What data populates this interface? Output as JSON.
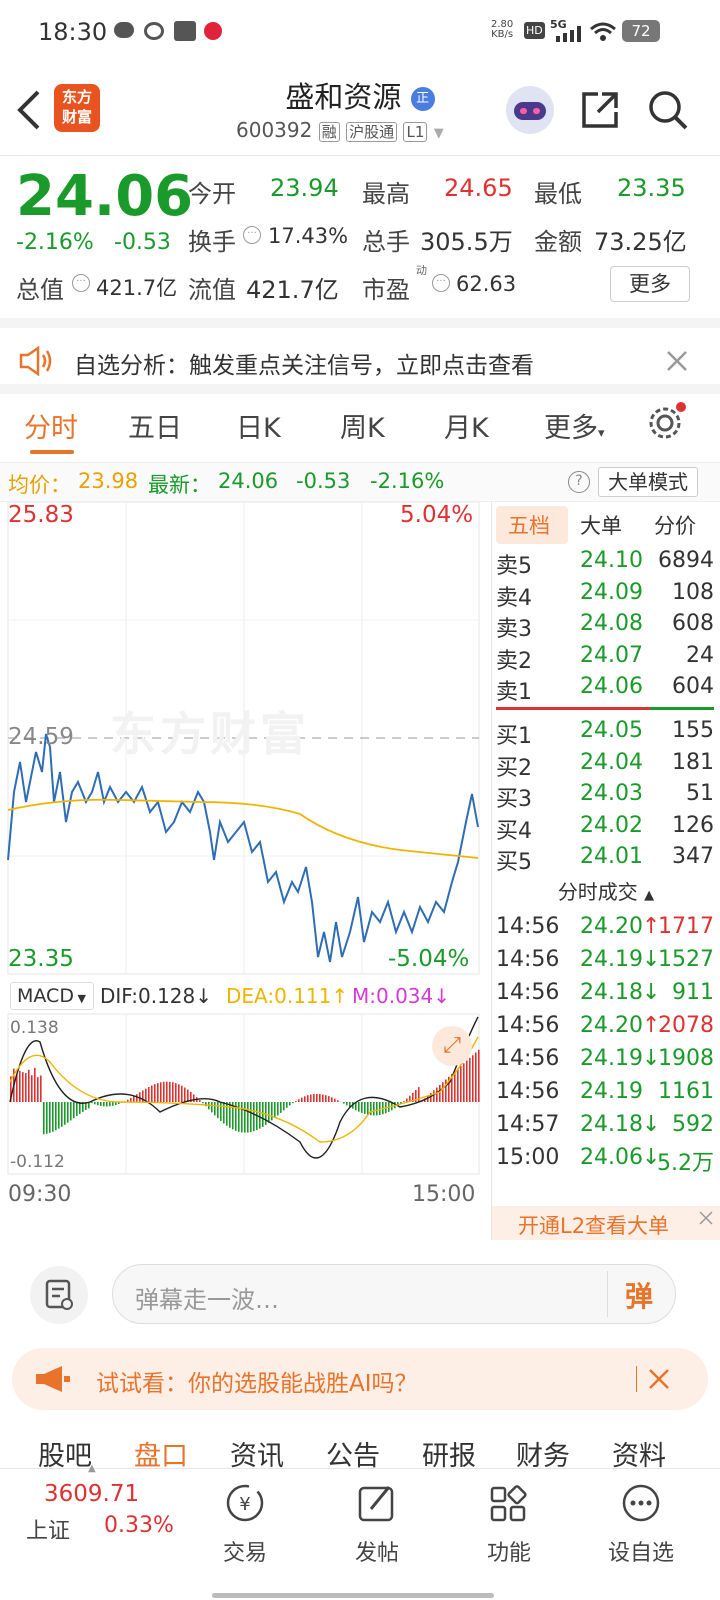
{
  "status_bar": {
    "time": "18:30",
    "net_speed_top": "2.80",
    "net_speed_bottom": "KB/s",
    "hd": "HD",
    "network": "5G",
    "battery": "72"
  },
  "header": {
    "logo_line1": "东方",
    "logo_line2": "财富",
    "stock_name": "盛和资源",
    "name_badge": "正",
    "code": "600392",
    "tag_margin": "融",
    "tag_connect": "沪股通",
    "tag_level": "L1"
  },
  "quote": {
    "price": "24.06",
    "change_pct": "-2.16%",
    "change": "-0.53",
    "open_label": "今开",
    "open": "23.94",
    "high_label": "最高",
    "high": "24.65",
    "low_label": "最低",
    "low": "23.35",
    "turnover_label": "换手",
    "turnover": "17.43%",
    "volume_label": "总手",
    "volume": "305.5万",
    "amount_label": "金额",
    "amount": "73.25亿",
    "mktcap_label": "总值",
    "mktcap": "421.7亿",
    "float_label": "流值",
    "float": "421.7亿",
    "pe_label": "市盈",
    "pe_sup": "动",
    "pe": "62.63",
    "more": "更多"
  },
  "banner": {
    "text": "自选分析：触发重点关注信号，立即点击查看"
  },
  "tabs": [
    "分时",
    "五日",
    "日K",
    "周K",
    "月K",
    "更多"
  ],
  "infoline": {
    "avg_label": "均价：",
    "avg": "23.98",
    "latest_label": "最新：",
    "latest": "24.06",
    "chg": "-0.53",
    "chg_pct": "-2.16%",
    "mode": "大单模式"
  },
  "chart": {
    "y_top": "25.83",
    "y_top_pct": "5.04%",
    "ref": "24.59",
    "y_bottom": "23.35",
    "y_bottom_pct": "-5.04%",
    "watermark": "东方财富",
    "x_start": "09:30",
    "x_end": "15:00",
    "macd_label": "MACD",
    "dif": "DIF:0.128",
    "dea": "DEA:0.111",
    "m": "M:0.034",
    "macd_top": "0.138",
    "macd_bottom": "-0.112",
    "colors": {
      "price": "#2e6db4",
      "avg": "#f0b400",
      "up": "#e03131",
      "down": "#1a9a2a"
    }
  },
  "book": {
    "tabs": [
      "五档",
      "大单",
      "分价"
    ],
    "asks": [
      {
        "label": "卖5",
        "price": "24.10",
        "vol": "6894"
      },
      {
        "label": "卖4",
        "price": "24.09",
        "vol": "108"
      },
      {
        "label": "卖3",
        "price": "24.08",
        "vol": "608"
      },
      {
        "label": "卖2",
        "price": "24.07",
        "vol": "24"
      },
      {
        "label": "卖1",
        "price": "24.06",
        "vol": "604"
      }
    ],
    "bids": [
      {
        "label": "买1",
        "price": "24.05",
        "vol": "155"
      },
      {
        "label": "买2",
        "price": "24.04",
        "vol": "181"
      },
      {
        "label": "买3",
        "price": "24.03",
        "vol": "51"
      },
      {
        "label": "买4",
        "price": "24.02",
        "vol": "126"
      },
      {
        "label": "买5",
        "price": "24.01",
        "vol": "347"
      }
    ],
    "ticks_title": "分时成交",
    "ticks": [
      {
        "time": "14:56",
        "price": "24.20",
        "dir": "↑",
        "vol": "1717"
      },
      {
        "time": "14:56",
        "price": "24.19",
        "dir": "↓",
        "vol": "1527"
      },
      {
        "time": "14:56",
        "price": "24.18",
        "dir": "↓",
        "vol": "911"
      },
      {
        "time": "14:56",
        "price": "24.20",
        "dir": "↑",
        "vol": "2078"
      },
      {
        "time": "14:56",
        "price": "24.19",
        "dir": "↓",
        "vol": "1908"
      },
      {
        "time": "14:56",
        "price": "24.19",
        "dir": "",
        "vol": "1161"
      },
      {
        "time": "14:57",
        "price": "24.18",
        "dir": "↓",
        "vol": "592"
      },
      {
        "time": "15:00",
        "price": "24.06",
        "dir": "↓",
        "vol": "5.2万"
      }
    ],
    "l2_text": "开通L2查看大单"
  },
  "comment": {
    "placeholder": "弹幕走一波…",
    "send": "弹"
  },
  "promo": {
    "text": "试试看：你的选股能战胜AI吗？"
  },
  "subtabs": [
    "股吧",
    "盘口",
    "资讯",
    "公告",
    "研报",
    "财务",
    "资料"
  ],
  "bottom": {
    "index_value": "3609.71",
    "index_name": "上证",
    "index_pct": "0.33%",
    "nav": [
      {
        "label": "交易",
        "icon": "yen-icon"
      },
      {
        "label": "发帖",
        "icon": "edit-icon"
      },
      {
        "label": "功能",
        "icon": "grid-icon"
      },
      {
        "label": "设自选",
        "icon": "more-icon"
      }
    ]
  }
}
